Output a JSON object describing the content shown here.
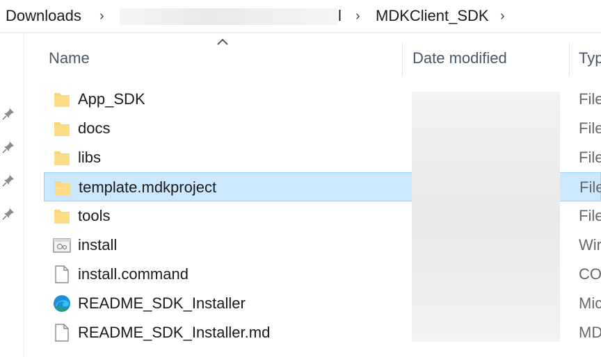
{
  "breadcrumb": {
    "items": [
      "Downloads",
      "l",
      "MDKClient_SDK"
    ]
  },
  "columns": {
    "name": "Name",
    "date_modified": "Date modified",
    "type": "Typ"
  },
  "files": [
    {
      "name": "App_SDK",
      "type": "File",
      "icon": "folder-icon"
    },
    {
      "name": "docs",
      "type": "File",
      "icon": "folder-icon"
    },
    {
      "name": "libs",
      "type": "File",
      "icon": "folder-icon"
    },
    {
      "name": "template.mdkproject",
      "type": "File",
      "icon": "folder-icon",
      "selected": true
    },
    {
      "name": "tools",
      "type": "File",
      "icon": "folder-icon"
    },
    {
      "name": "install",
      "type": "Wir",
      "icon": "script-icon"
    },
    {
      "name": "install.command",
      "type": "CO",
      "icon": "document-icon"
    },
    {
      "name": "README_SDK_Installer",
      "type": "Mic",
      "icon": "edge-icon"
    },
    {
      "name": "README_SDK_Installer.md",
      "type": "MD",
      "icon": "document-icon"
    }
  ],
  "colors": {
    "selection_bg": "#cce8ff",
    "selection_border": "#99d1ff",
    "folder": "#f8d775",
    "header_text": "#4a5566"
  }
}
